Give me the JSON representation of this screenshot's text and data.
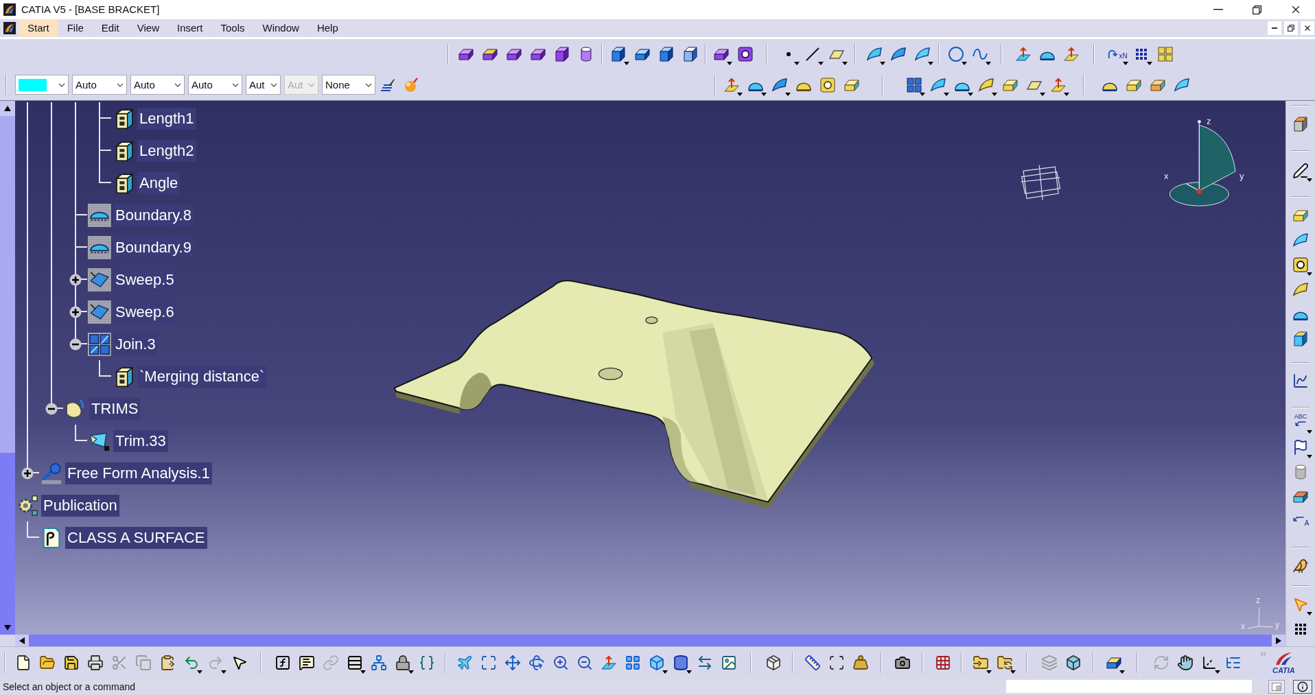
{
  "window": {
    "title": "CATIA V5 - [BASE BRACKET]"
  },
  "menu": [
    {
      "label": "Start",
      "selected": true
    },
    {
      "label": "File",
      "selected": false
    },
    {
      "label": "Edit",
      "selected": false
    },
    {
      "label": "View",
      "selected": false
    },
    {
      "label": "Insert",
      "selected": false
    },
    {
      "label": "Tools",
      "selected": false
    },
    {
      "label": "Window",
      "selected": false
    },
    {
      "label": "Help",
      "selected": false
    }
  ],
  "format_toolbar": [
    {
      "kind": "color",
      "color": "#00ffff",
      "disabled": false
    },
    {
      "kind": "list",
      "value": "Auto",
      "disabled": false
    },
    {
      "kind": "list",
      "value": "Auto",
      "disabled": false
    },
    {
      "kind": "list",
      "value": "Auto",
      "disabled": false
    },
    {
      "kind": "list",
      "value": "Aut",
      "disabled": false
    },
    {
      "kind": "list",
      "value": "Aut",
      "disabled": true
    },
    {
      "kind": "list",
      "value": "None",
      "disabled": false
    }
  ],
  "icon_captions": {
    "repeat_tool": "xN",
    "text_tool": "ABC",
    "flag_tool": "A"
  },
  "tree": [
    {
      "children": [
        {
          "children": [
            {
              "children": [
                {
                  "children": [
                    {
                      "label": "Length1",
                      "kind": "parameter",
                      "hidden": false
                    },
                    {
                      "label": "Length2",
                      "kind": "parameter",
                      "hidden": false
                    },
                    {
                      "label": "Angle",
                      "kind": "parameter",
                      "hidden": false
                    }
                  ]
                },
                {
                  "label": "Boundary.8",
                  "kind": "boundary",
                  "hidden": true
                },
                {
                  "label": "Boundary.9",
                  "kind": "boundary",
                  "hidden": true
                },
                {
                  "label": "Sweep.5",
                  "kind": "sweep",
                  "hidden": true,
                  "expanded": false
                },
                {
                  "label": "Sweep.6",
                  "kind": "sweep",
                  "hidden": true,
                  "expanded": false
                },
                {
                  "label": "Join.3",
                  "kind": "join",
                  "hidden": true,
                  "expanded": true,
                  "children": [
                    {
                      "label": "`Merging distance`",
                      "kind": "parameter",
                      "hidden": false
                    }
                  ]
                }
              ]
            },
            {
              "label": "TRIMS",
              "kind": "geometrical_set",
              "hidden": false,
              "expanded": true,
              "children": [
                {
                  "label": "Trim.33",
                  "kind": "trim",
                  "hidden": false
                }
              ]
            }
          ]
        },
        {
          "label": "Free Form Analysis.1",
          "kind": "analysis",
          "hidden": false,
          "expanded": false
        }
      ]
    },
    {
      "label": "Publication",
      "kind": "publication",
      "hidden": false,
      "children": [
        {
          "label": "CLASS A SURFACE",
          "kind": "published_element",
          "hidden": false
        }
      ]
    }
  ],
  "compass": {
    "z_label": "z",
    "y_label": "y",
    "x_label": "x"
  },
  "axis_triad": {
    "z_label": "z",
    "y_label": "y",
    "x_label": "x"
  },
  "logo": {
    "text": "CATIA"
  },
  "status_bar": {
    "message": "Select an object or a command"
  }
}
